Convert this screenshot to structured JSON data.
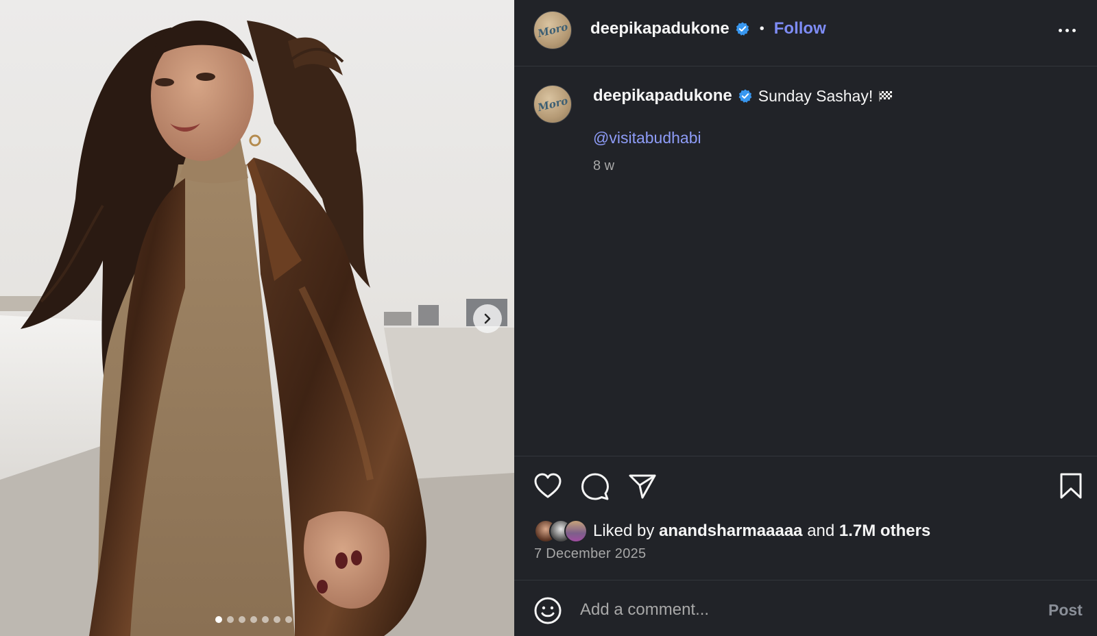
{
  "post": {
    "username": "deepikapadukone",
    "follow_label": "Follow",
    "separator": "•",
    "avatar_text": "Moro",
    "caption": "Sunday Sashay!",
    "mention": "@visitabudhabi",
    "age": "8 w",
    "liked_prefix": "Liked by",
    "liked_user": "anandsharmaaaaa",
    "liked_and": "and",
    "liked_others": "1.7M others",
    "date": "7 December 2025",
    "comment_placeholder": "Add a comment...",
    "post_label": "Post"
  },
  "carousel": {
    "total_slides": 7,
    "current_slide": 1
  },
  "icons": {
    "verified": "verified-badge-icon",
    "flag": "chequered-flag-emoji",
    "like": "heart-icon",
    "comment": "comment-bubble-icon",
    "share": "send-paper-plane-icon",
    "save": "bookmark-icon",
    "emoji": "smiley-icon",
    "more": "more-options-icon",
    "next": "chevron-right-icon"
  },
  "colors": {
    "background": "#212328",
    "accent_link": "#7e8cf5",
    "verified": "#3897f0",
    "muted_text": "#a8a8a8"
  }
}
